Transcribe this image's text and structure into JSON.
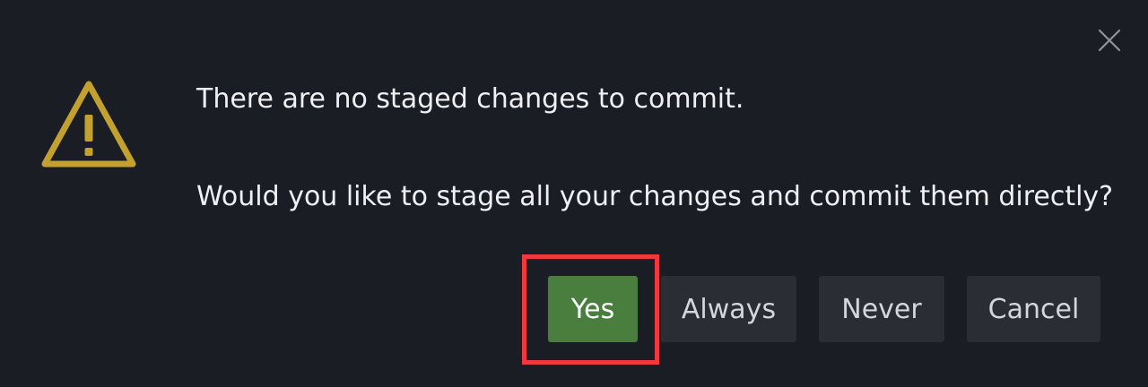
{
  "dialog": {
    "message_line1": "There are no staged changes to commit.",
    "message_line2": "Would you like to stage all your changes and commit them directly?",
    "icons": {
      "warning": "warning-icon",
      "close": "close-icon"
    }
  },
  "buttons": {
    "yes": "Yes",
    "always": "Always",
    "never": "Never",
    "cancel": "Cancel"
  },
  "colors": {
    "background": "#1b1d25",
    "warning": "#c3a12f",
    "primary_button": "#4a7e3f",
    "secondary_button": "#2a2d33",
    "highlight": "#f0383e"
  }
}
